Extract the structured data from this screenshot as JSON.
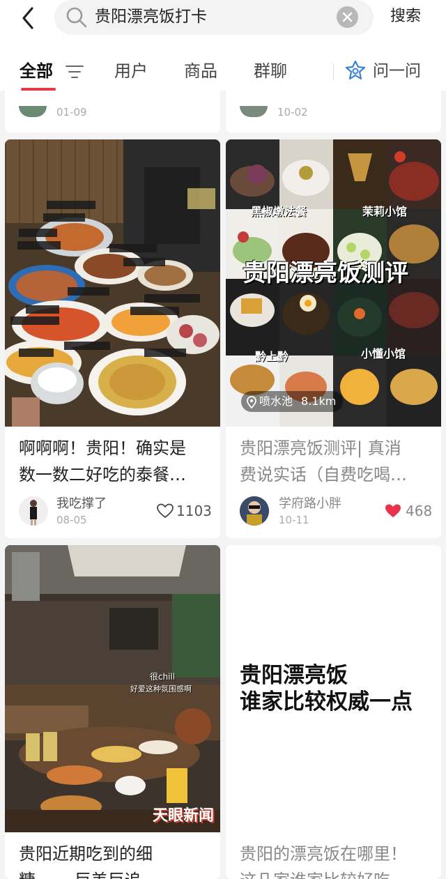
{
  "search": {
    "query": "贵阳漂亮饭打卡",
    "button_label": "搜索"
  },
  "tabs": [
    {
      "label": "全部"
    },
    {
      "label": "用户"
    },
    {
      "label": "商品"
    },
    {
      "label": "群聊"
    }
  ],
  "ask": {
    "label": "问一问"
  },
  "peek_cards": [
    {
      "date": "01-09"
    },
    {
      "date": "10-02"
    }
  ],
  "cards": [
    {
      "title_line1": "啊啊啊！贵阳！确实是",
      "title_line2": "数一数二好吃的泰餐…",
      "author": "我吃撑了",
      "date": "08-05",
      "likes": "1103",
      "liked": false
    },
    {
      "image_title": "贵阳漂亮饭测评",
      "image_labels": [
        "黑椒墩法餐",
        "茉莉小馆",
        "黔上黔",
        "小懂小馆"
      ],
      "location": "喷水池",
      "distance": "8.1km",
      "title_line1": "贵阳漂亮饭测评| 真消",
      "title_line2": "费说实话（自费吃喝…",
      "author": "学府路小胖",
      "date": "10-11",
      "likes": "468",
      "liked": true
    },
    {
      "image_caption_1": "很chill",
      "image_caption_2": "好爱这种氛围感啊",
      "image_watermark": "天眼新闻",
      "title_line1": "贵阳近期吃到的细",
      "title_line2": "糠…… 巨美巨追"
    },
    {
      "cover_line1": "贵阳漂亮饭",
      "cover_line2": "谁家比较权威一点",
      "title_line1": "贵阳的漂亮饭在哪里！",
      "title_line2": "这几家谁家比较好吃"
    }
  ],
  "colors": {
    "accent": "#e63946",
    "liked_heart": "#e8344a",
    "ask_icon": "#3b82d6"
  }
}
